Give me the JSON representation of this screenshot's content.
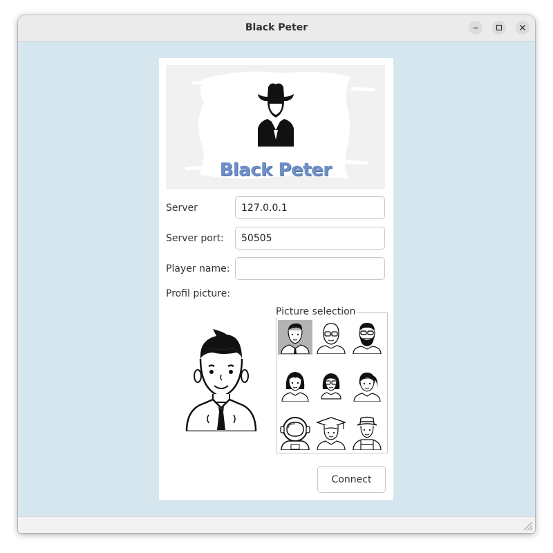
{
  "window": {
    "title": "Black Peter"
  },
  "banner": {
    "brand_text": "Black Peter"
  },
  "form": {
    "server_label": "Server",
    "server_value": "127.0.0.1",
    "port_label": "Server port:",
    "port_value": "50505",
    "player_label": "Player name:",
    "player_value": "",
    "profile_label": "Profil picture:"
  },
  "picture_selection": {
    "title": "Picture selection",
    "selected_index": 0,
    "options": [
      "man-tie-avatar",
      "bald-glasses-man-avatar",
      "bearded-glasses-man-avatar",
      "woman-avatar",
      "glasses-woman-avatar",
      "ponytail-woman-avatar",
      "astronaut-avatar",
      "graduate-avatar",
      "farmer-hat-avatar"
    ]
  },
  "actions": {
    "connect_label": "Connect"
  },
  "colors": {
    "background": "#d5e6ee",
    "brand": "#6e8fc7",
    "selected": "#b3b3b3"
  }
}
